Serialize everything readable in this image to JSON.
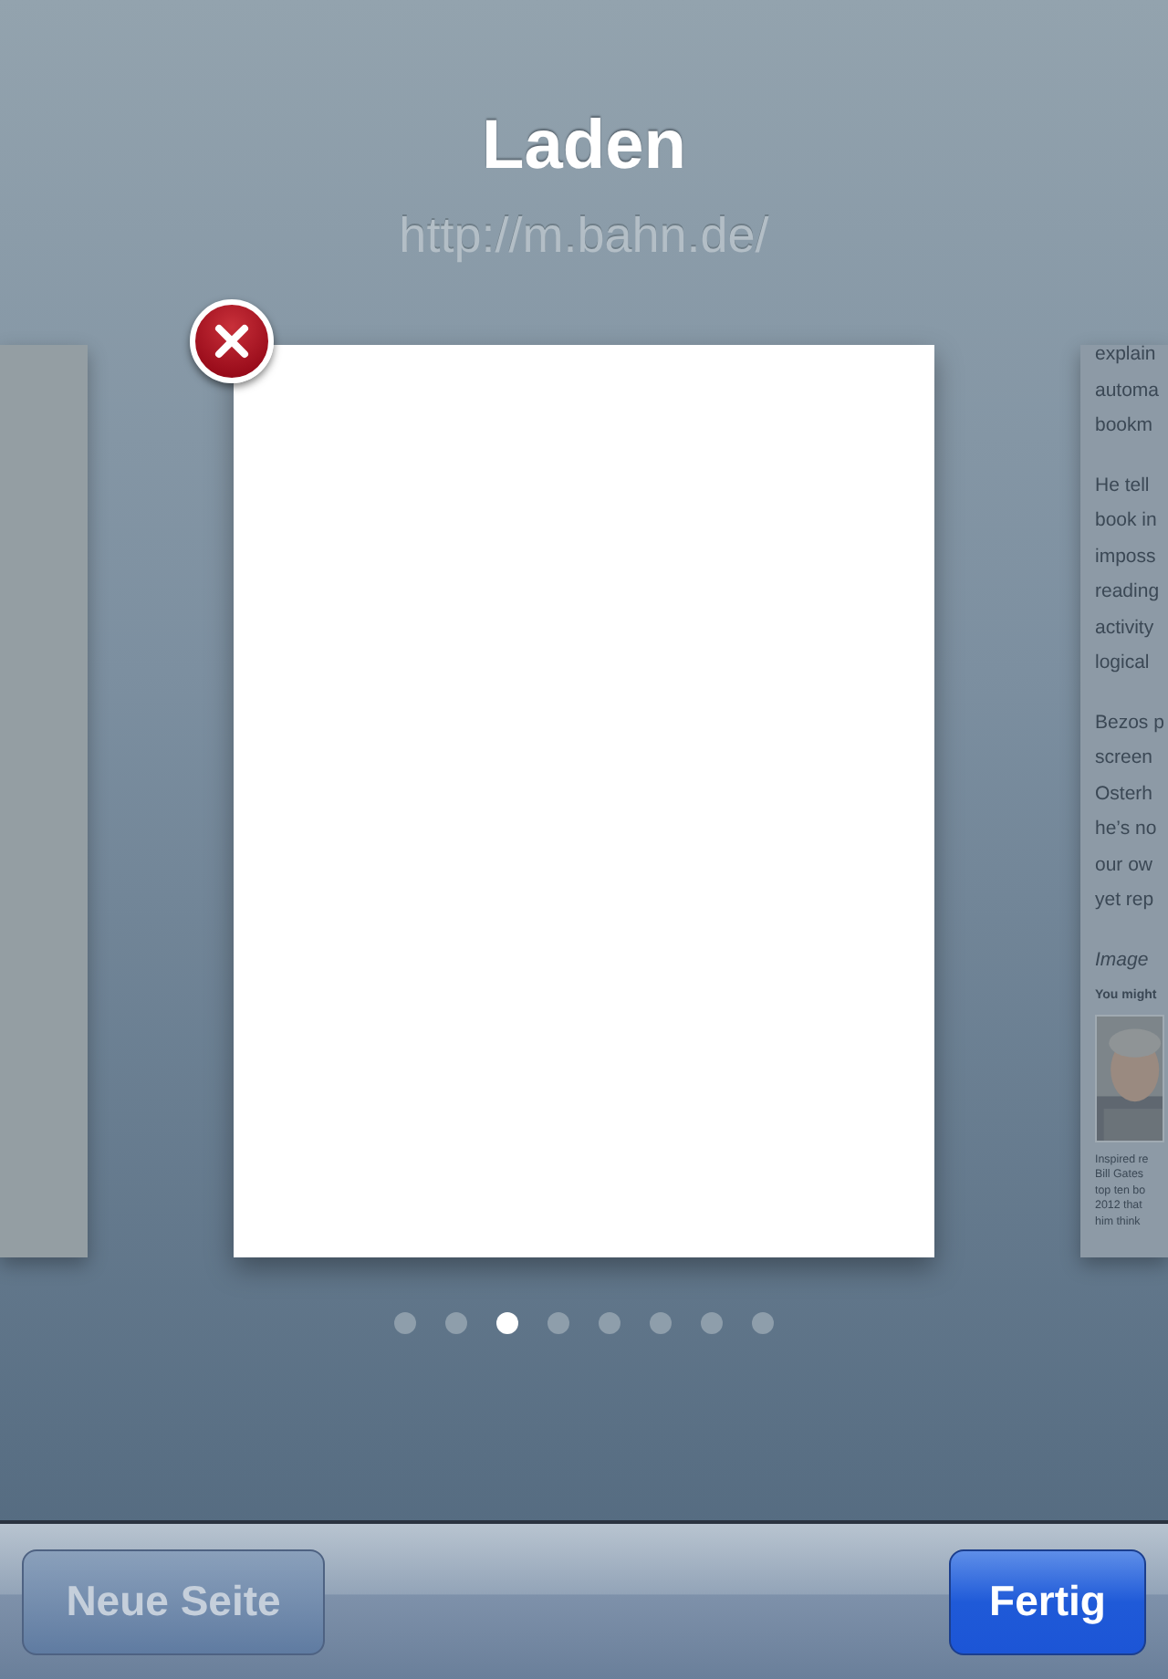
{
  "title": "Laden",
  "url": "http://m.bahn.de/",
  "next_page": {
    "paragraphs": [
      [
        "explain",
        "automa",
        "bookm"
      ],
      [
        "He tell",
        "book in",
        "imposs",
        "reading",
        "activity",
        "logical"
      ],
      [
        "Bezos p",
        "screen",
        "Osterh",
        "he’s no",
        "our ow",
        "yet rep"
      ]
    ],
    "caption_heading": "Image",
    "related_heading": "You might",
    "related_image": {
      "kind": "picture"
    },
    "related_text": [
      "Inspired re",
      "Bill Gates",
      "top ten bo",
      "2012 that",
      "him think"
    ]
  },
  "page_dots": [
    {
      "selected": false
    },
    {
      "selected": false
    },
    {
      "selected": true
    },
    {
      "selected": false
    },
    {
      "selected": false
    },
    {
      "selected": false
    },
    {
      "selected": false
    },
    {
      "selected": false
    }
  ],
  "buttons": [
    {
      "label": "Neue Seite",
      "kind": "secondary"
    },
    {
      "label": "Fertig",
      "kind": "primary"
    }
  ]
}
